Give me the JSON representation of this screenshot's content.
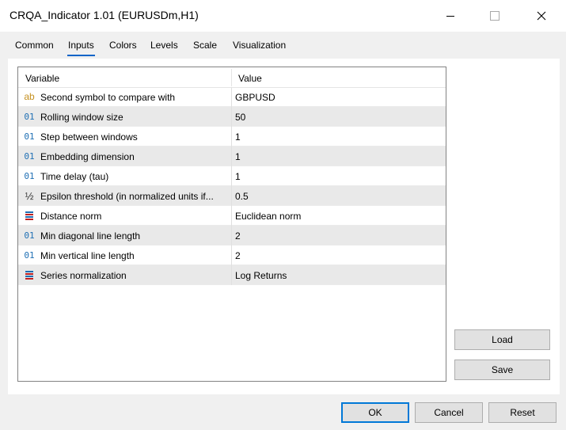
{
  "window": {
    "title": "CRQA_Indicator 1.01 (EURUSDm,H1)"
  },
  "tabs": [
    {
      "label": "Common"
    },
    {
      "label": "Inputs"
    },
    {
      "label": "Colors"
    },
    {
      "label": "Levels"
    },
    {
      "label": "Scale"
    },
    {
      "label": "Visualization"
    }
  ],
  "active_tab": "Inputs",
  "grid": {
    "columns": [
      "Variable",
      "Value"
    ],
    "rows": [
      {
        "icon": "string-type-icon",
        "glyph": "ab",
        "name": "Second symbol to compare with",
        "value": "GBPUSD"
      },
      {
        "icon": "integer-type-icon",
        "glyph": "01",
        "name": "Rolling window size",
        "value": "50"
      },
      {
        "icon": "integer-type-icon",
        "glyph": "01",
        "name": "Step between windows",
        "value": "1"
      },
      {
        "icon": "integer-type-icon",
        "glyph": "01",
        "name": "Embedding dimension",
        "value": "1"
      },
      {
        "icon": "integer-type-icon",
        "glyph": "01",
        "name": "Time delay (tau)",
        "value": "1"
      },
      {
        "icon": "double-type-icon",
        "glyph": "½",
        "name": "Epsilon threshold (in normalized units if...",
        "value": "0.5"
      },
      {
        "icon": "enum-type-icon",
        "glyph": "",
        "name": "Distance norm",
        "value": "Euclidean norm"
      },
      {
        "icon": "integer-type-icon",
        "glyph": "01",
        "name": "Min diagonal line length",
        "value": "2"
      },
      {
        "icon": "integer-type-icon",
        "glyph": "01",
        "name": "Min vertical line length",
        "value": "2"
      },
      {
        "icon": "enum-type-icon",
        "glyph": "",
        "name": "Series normalization",
        "value": "Log Returns"
      }
    ]
  },
  "side_buttons": {
    "load": "Load",
    "save": "Save"
  },
  "footer_buttons": {
    "ok": "OK",
    "cancel": "Cancel",
    "reset": "Reset"
  },
  "colors": {
    "accent": "#0078d7",
    "tab_underline": "#0a64c8",
    "string_icon": "#c5901f",
    "integer_icon": "#1f6fb4"
  }
}
